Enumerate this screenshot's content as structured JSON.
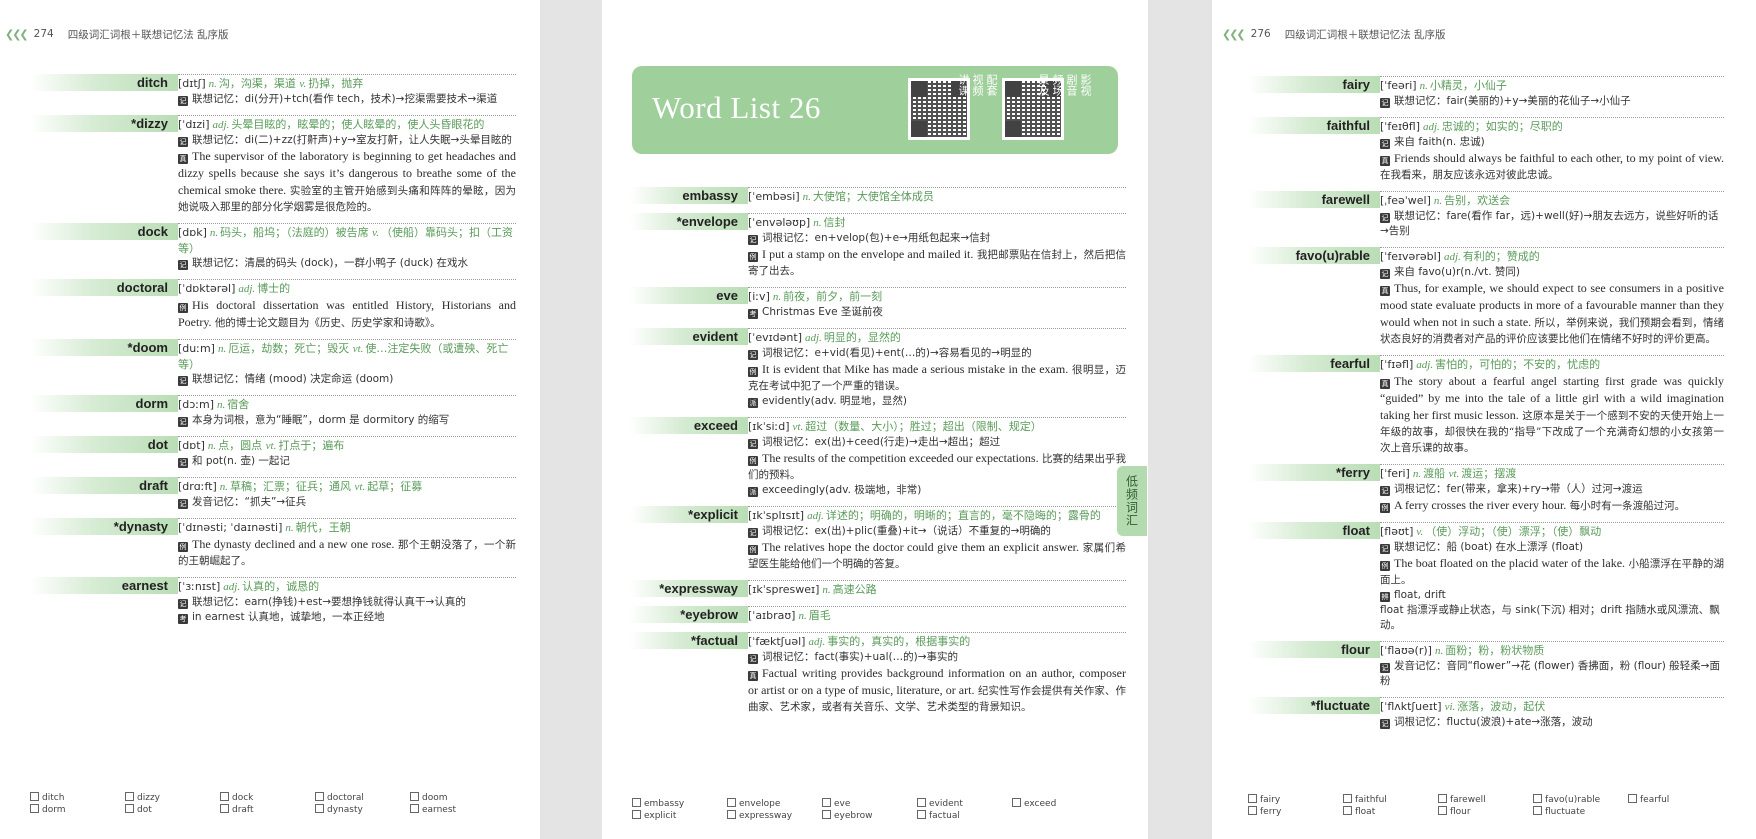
{
  "left_page": {
    "page_number": "274",
    "running_title": "四级词汇词根＋联想记忆法 乱序版",
    "entries": [
      {
        "word": "ditch",
        "phonetic": "[dɪtʃ]",
        "pos1": "n.",
        "def1": "沟，沟渠，渠道",
        "pos2": "v.",
        "def2": "扔掉，抛弃",
        "lines": [
          {
            "tag": "记",
            "text": "联想记忆：di(分开)+tch(看作 tech，技术)→挖渠需要技术→渠道"
          }
        ]
      },
      {
        "word": "*dizzy",
        "phonetic": "[ˈdɪzi]",
        "pos1": "adj.",
        "def1": "头晕目眩的，眩晕的；使人眩晕的，使人头昏眼花的",
        "pos2": "",
        "def2": "",
        "lines": [
          {
            "tag": "记",
            "text": "联想记忆：di(二)+zz(打鼾声)+y→室友打鼾，让人失眠→头晕目眩的"
          }
        ],
        "example": {
          "tag": "真",
          "en": "The supervisor of the laboratory is beginning to get headaches and dizzy spells because she says it’s dangerous to breathe some of the chemical smoke there.",
          "zh": "实验室的主管开始感到头痛和阵阵的晕眩，因为她说吸入那里的部分化学烟雾是很危险的。"
        }
      },
      {
        "word": "dock",
        "phonetic": "[dɒk]",
        "pos1": "n.",
        "def1": "码头，船坞；（法庭的）被告席",
        "pos2": "v.",
        "def2": "（使船）靠码头；扣（工资等）",
        "lines": [
          {
            "tag": "记",
            "text": "联想记忆：清晨的码头 (dock)，一群小鸭子 (duck) 在戏水"
          }
        ]
      },
      {
        "word": "doctoral",
        "phonetic": "[ˈdɒktərəl]",
        "pos1": "adj.",
        "def1": "博士的",
        "pos2": "",
        "def2": "",
        "lines": [],
        "example": {
          "tag": "例",
          "en": "His doctoral dissertation was entitled History, Historians and Poetry.",
          "zh": "他的博士论文题目为《历史、历史学家和诗歌》。"
        }
      },
      {
        "word": "*doom",
        "phonetic": "[duːm]",
        "pos1": "n.",
        "def1": "厄运，劫数；死亡；毁灭",
        "pos2": "vt.",
        "def2": "使…注定失败（或遭殃、死亡等）",
        "lines": [
          {
            "tag": "记",
            "text": "联想记忆：情绪 (mood) 决定命运 (doom)"
          }
        ]
      },
      {
        "word": "dorm",
        "phonetic": "[dɔːm]",
        "pos1": "n.",
        "def1": "宿舍",
        "pos2": "",
        "def2": "",
        "lines": [
          {
            "tag": "记",
            "text": "本身为词根，意为“睡眠”，dorm 是 dormitory 的缩写"
          }
        ]
      },
      {
        "word": "dot",
        "phonetic": "[dɒt]",
        "pos1": "n.",
        "def1": "点，圆点",
        "pos2": "vt.",
        "def2": "打点于；遍布",
        "lines": [
          {
            "tag": "记",
            "text": "和 pot(n. 壶) 一起记"
          }
        ]
      },
      {
        "word": "draft",
        "phonetic": "[drɑːft]",
        "pos1": "n.",
        "def1": "草稿；汇票；征兵；通风",
        "pos2": "vt.",
        "def2": "起草；征募",
        "lines": [
          {
            "tag": "记",
            "text": "发音记忆：“抓夫”→征兵"
          }
        ]
      },
      {
        "word": "*dynasty",
        "phonetic": "[ˈdɪnəsti; ˈdaɪnəsti]",
        "pos1": "n.",
        "def1": "朝代，王朝",
        "pos2": "",
        "def2": "",
        "lines": [],
        "example": {
          "tag": "例",
          "en": "The dynasty declined and a new one rose.",
          "zh": "那个王朝没落了，一个新的王朝崛起了。"
        }
      },
      {
        "word": "earnest",
        "phonetic": "[ˈɜːnɪst]",
        "pos1": "adj.",
        "def1": "认真的，诚恳的",
        "pos2": "",
        "def2": "",
        "lines": [
          {
            "tag": "记",
            "text": "联想记忆：earn(挣钱)+est→要想挣钱就得认真干→认真的"
          },
          {
            "tag": "考",
            "text": "in earnest 认真地，诚挚地，一本正经地"
          }
        ]
      }
    ],
    "checklist": [
      "ditch",
      "dorm",
      "dizzy",
      "dot",
      "dock",
      "draft",
      "doctoral",
      "dynasty",
      "doom",
      "earnest"
    ]
  },
  "middle_page": {
    "banner_title": "Word List 26",
    "qr_caption_1": [
      "配套",
      "视频",
      "讲课"
    ],
    "qr_caption_2": [
      "影视",
      "剧音",
      "频场",
      "景及"
    ],
    "side_tab": "低频词汇",
    "entries": [
      {
        "word": "embassy",
        "phonetic": "[ˈembəsi]",
        "pos1": "n.",
        "def1": "大使馆；大使馆全体成员",
        "pos2": "",
        "def2": "",
        "lines": []
      },
      {
        "word": "*envelope",
        "phonetic": "[ˈenvələʊp]",
        "pos1": "n.",
        "def1": "信封",
        "pos2": "",
        "def2": "",
        "lines": [
          {
            "tag": "记",
            "text": "词根记忆：en+velop(包)+e→用纸包起来→信封"
          }
        ],
        "example": {
          "tag": "例",
          "en": "I put a stamp on the envelope and mailed it.",
          "zh": "我把邮票贴在信封上，然后把信寄了出去。"
        }
      },
      {
        "word": "eve",
        "phonetic": "[iːv]",
        "pos1": "n.",
        "def1": "前夜，前夕，前一刻",
        "pos2": "",
        "def2": "",
        "lines": [
          {
            "tag": "考",
            "text": "Christmas Eve 圣诞前夜"
          }
        ]
      },
      {
        "word": "evident",
        "phonetic": "[ˈevɪdənt]",
        "pos1": "adj.",
        "def1": "明显的，显然的",
        "pos2": "",
        "def2": "",
        "lines": [
          {
            "tag": "记",
            "text": "词根记忆：e+vid(看见)+ent(…的)→容易看见的→明显的"
          }
        ],
        "example": {
          "tag": "例",
          "en": "It is evident that Mike has made a serious mistake in the exam.",
          "zh": "很明显，迈克在考试中犯了一个严重的错误。"
        },
        "after": [
          {
            "tag": "派",
            "text": "evidently(adv. 明显地，显然)"
          }
        ]
      },
      {
        "word": "exceed",
        "phonetic": "[ɪkˈsiːd]",
        "pos1": "vt.",
        "def1": "超过（数量、大小）；胜过；超出（限制、规定）",
        "pos2": "",
        "def2": "",
        "lines": [
          {
            "tag": "记",
            "text": "词根记忆：ex(出)+ceed(行走)→走出→超出；超过"
          }
        ],
        "example": {
          "tag": "例",
          "en": "The results of the competition exceeded our expectations.",
          "zh": "比赛的结果出乎我们的预料。"
        },
        "after": [
          {
            "tag": "派",
            "text": "exceedingly(adv. 极端地，非常)"
          }
        ]
      },
      {
        "word": "*explicit",
        "phonetic": "[ɪkˈsplɪsɪt]",
        "pos1": "adj.",
        "def1": "详述的；明确的，明晰的；直言的，毫不隐晦的；露骨的",
        "pos2": "",
        "def2": "",
        "lines": [
          {
            "tag": "记",
            "text": "词根记忆：ex(出)+plic(重叠)+it→（说话）不重复的→明确的"
          }
        ],
        "example": {
          "tag": "例",
          "en": "The relatives hope the doctor could give them an explicit answer.",
          "zh": "家属们希望医生能给他们一个明确的答复。"
        }
      },
      {
        "word": "*expressway",
        "phonetic": "[ɪkˈspresweɪ]",
        "pos1": "n.",
        "def1": "高速公路",
        "pos2": "",
        "def2": "",
        "lines": []
      },
      {
        "word": "*eyebrow",
        "phonetic": "[ˈaɪbraʊ]",
        "pos1": "n.",
        "def1": "眉毛",
        "pos2": "",
        "def2": "",
        "lines": []
      },
      {
        "word": "*factual",
        "phonetic": "[ˈfæktʃuəl]",
        "pos1": "adj.",
        "def1": "事实的，真实的，根据事实的",
        "pos2": "",
        "def2": "",
        "lines": [
          {
            "tag": "记",
            "text": "词根记忆：fact(事实)+ual(…的)→事实的"
          }
        ],
        "example": {
          "tag": "真",
          "en": "Factual writing provides background information on an author, composer or artist or on a type of music, literature, or art.",
          "zh": "纪实性写作会提供有关作家、作曲家、艺术家，或者有关音乐、文学、艺术类型的背景知识。"
        }
      }
    ],
    "checklist": [
      "embassy",
      "explicit",
      "envelope",
      "expressway",
      "eve",
      "eyebrow",
      "evident",
      "factual",
      "exceed"
    ]
  },
  "right_page": {
    "page_number": "276",
    "running_title": "四级词汇词根＋联想记忆法 乱序版",
    "entries": [
      {
        "word": "fairy",
        "phonetic": "[ˈfeəri]",
        "pos1": "n.",
        "def1": "小精灵，小仙子",
        "pos2": "",
        "def2": "",
        "lines": [
          {
            "tag": "记",
            "text": "联想记忆：fair(美丽的)+y→美丽的花仙子→小仙子"
          }
        ]
      },
      {
        "word": "faithful",
        "phonetic": "[ˈfeɪθfl]",
        "pos1": "adj.",
        "def1": "忠诚的；如实的；尽职的",
        "pos2": "",
        "def2": "",
        "lines": [
          {
            "tag": "记",
            "text": "来自 faith(n. 忠诚)"
          }
        ],
        "example": {
          "tag": "真",
          "en": "Friends should always be faithful to each other, to my point of view.",
          "zh": "在我看来，朋友应该永远对彼此忠诚。"
        }
      },
      {
        "word": "farewell",
        "phonetic": "[ˌfeəˈwel]",
        "pos1": "n.",
        "def1": "告别，欢送会",
        "pos2": "",
        "def2": "",
        "lines": [
          {
            "tag": "记",
            "text": "联想记忆：fare(看作 far，远)+well(好)→朋友去远方，说些好听的话→告别"
          }
        ]
      },
      {
        "word": "favo(u)rable",
        "phonetic": "[ˈfeɪvərəbl]",
        "pos1": "adj.",
        "def1": "有利的；赞成的",
        "pos2": "",
        "def2": "",
        "lines": [
          {
            "tag": "记",
            "text": "来自 favo(u)r(n./vt. 赞同)"
          }
        ],
        "example": {
          "tag": "真",
          "en": "Thus, for example, we should expect to see consumers in a positive mood state evaluate products in more of a favourable manner than they would when not in such a state.",
          "zh": "所以，举例来说，我们预期会看到，情绪状态良好的消费者对产品的评价应该要比他们在情绪不好时的评价更高。"
        }
      },
      {
        "word": "fearful",
        "phonetic": "[ˈfɪəfl]",
        "pos1": "adj.",
        "def1": "害怕的，可怕的；不安的，忧虑的",
        "pos2": "",
        "def2": "",
        "lines": [],
        "example": {
          "tag": "真",
          "en": "The story about a fearful angel starting first grade was quickly “guided” by me into the tale of a little girl with a wild imagination taking her first music lesson.",
          "zh": "这原本是关于一个感到不安的天使开始上一年级的故事，却很快在我的“指导”下改成了一个充满奇幻想的小女孩第一次上音乐课的故事。"
        }
      },
      {
        "word": "*ferry",
        "phonetic": "[ˈferi]",
        "pos1": "n.",
        "def1": "渡船",
        "pos2": "vt.",
        "def2": "渡运；摆渡",
        "lines": [
          {
            "tag": "记",
            "text": "词根记忆：fer(带来，拿来)+ry→带（人）过河→渡运"
          }
        ],
        "example": {
          "tag": "例",
          "en": "A ferry crosses the river every hour.",
          "zh": "每小时有一条渡船过河。"
        }
      },
      {
        "word": "float",
        "phonetic": "[fləʊt]",
        "pos1": "v.",
        "def1": "（使）浮动；（使）漂浮；（使）飘动",
        "pos2": "",
        "def2": "",
        "lines": [
          {
            "tag": "记",
            "text": "联想记忆：船 (boat) 在水上漂浮 (float)"
          }
        ],
        "example": {
          "tag": "例",
          "en": "The boat floated on the placid water of the lake.",
          "zh": "小船漂浮在平静的湖面上。"
        },
        "after": [
          {
            "tag": "辨",
            "text": "float, drift"
          },
          {
            "tag": "",
            "text": "float 指漂浮或静止状态，与 sink(下沉) 相对；drift 指随水或风漂流、飘动。"
          }
        ]
      },
      {
        "word": "flour",
        "phonetic": "[ˈflaʊə(r)]",
        "pos1": "n.",
        "def1": "面粉；粉，粉状物质",
        "pos2": "",
        "def2": "",
        "lines": [
          {
            "tag": "记",
            "text": "发音记忆：音同“flower”→花 (flower) 香拂面，粉 (flour) 般轻柔→面粉"
          }
        ]
      },
      {
        "word": "*fluctuate",
        "phonetic": "[ˈflʌktʃueɪt]",
        "pos1": "vi.",
        "def1": "涨落，波动，起伏",
        "pos2": "",
        "def2": "",
        "lines": [
          {
            "tag": "记",
            "text": "词根记忆：fluctu(波浪)+ate→涨落，波动"
          }
        ]
      }
    ],
    "checklist": [
      "fairy",
      "ferry",
      "faithful",
      "float",
      "farewell",
      "flour",
      "favo(u)rable",
      "fluctuate",
      "fearful"
    ]
  }
}
